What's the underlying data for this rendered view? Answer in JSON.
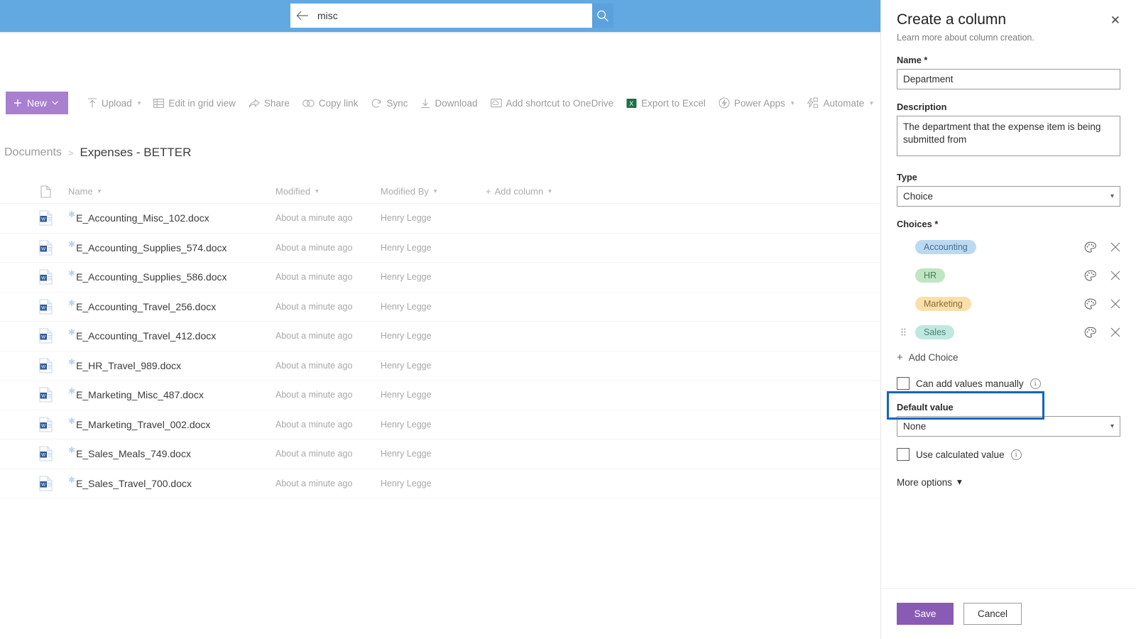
{
  "topbar": {
    "search_value": "misc",
    "search_placeholder": "Search",
    "back_icon": "back-arrow-icon",
    "search_icon": "search-icon"
  },
  "commandbar": {
    "new_label": "New",
    "items": [
      {
        "label": "Upload",
        "icon": "upload-icon",
        "caret": true
      },
      {
        "label": "Edit in grid view",
        "icon": "grid-icon",
        "caret": false
      },
      {
        "label": "Share",
        "icon": "share-icon",
        "caret": false
      },
      {
        "label": "Copy link",
        "icon": "link-icon",
        "caret": false
      },
      {
        "label": "Sync",
        "icon": "sync-icon",
        "caret": false
      },
      {
        "label": "Download",
        "icon": "download-icon",
        "caret": false
      },
      {
        "label": "Add shortcut to OneDrive",
        "icon": "onedrive-shortcut-icon",
        "caret": false
      },
      {
        "label": "Export to Excel",
        "icon": "excel-icon",
        "caret": false
      },
      {
        "label": "Power Apps",
        "icon": "power-apps-icon",
        "caret": true
      },
      {
        "label": "Automate",
        "icon": "automate-icon",
        "caret": true
      }
    ]
  },
  "breadcrumb": {
    "root": "Documents",
    "separator": ">",
    "current": "Expenses - BETTER"
  },
  "filelist": {
    "columns": {
      "name": "Name",
      "modified": "Modified",
      "modified_by": "Modified By",
      "add_column": "Add column"
    },
    "rows": [
      {
        "name": "E_Accounting_Misc_102.docx",
        "modified": "About a minute ago",
        "modified_by": "Henry Legge"
      },
      {
        "name": "E_Accounting_Supplies_574.docx",
        "modified": "About a minute ago",
        "modified_by": "Henry Legge"
      },
      {
        "name": "E_Accounting_Supplies_586.docx",
        "modified": "About a minute ago",
        "modified_by": "Henry Legge"
      },
      {
        "name": "E_Accounting_Travel_256.docx",
        "modified": "About a minute ago",
        "modified_by": "Henry Legge"
      },
      {
        "name": "E_Accounting_Travel_412.docx",
        "modified": "About a minute ago",
        "modified_by": "Henry Legge"
      },
      {
        "name": "E_HR_Travel_989.docx",
        "modified": "About a minute ago",
        "modified_by": "Henry Legge"
      },
      {
        "name": "E_Marketing_Misc_487.docx",
        "modified": "About a minute ago",
        "modified_by": "Henry Legge"
      },
      {
        "name": "E_Marketing_Travel_002.docx",
        "modified": "About a minute ago",
        "modified_by": "Henry Legge"
      },
      {
        "name": "E_Sales_Meals_749.docx",
        "modified": "About a minute ago",
        "modified_by": "Henry Legge"
      },
      {
        "name": "E_Sales_Travel_700.docx",
        "modified": "About a minute ago",
        "modified_by": "Henry Legge"
      }
    ]
  },
  "panel": {
    "title": "Create a column",
    "subtitle": "Learn more about column creation.",
    "close_icon": "close-icon",
    "name_label": "Name *",
    "name_value": "Department",
    "description_label": "Description",
    "description_value": "The department that the expense item is being submitted from",
    "type_label": "Type",
    "type_value": "Choice",
    "choices_label": "Choices *",
    "choices": [
      {
        "label": "Accounting",
        "bg": "#bcd9f2",
        "fg": "#4a6f8f",
        "drag": false
      },
      {
        "label": "HR",
        "bg": "#bfe6c2",
        "fg": "#4f7a53",
        "drag": false
      },
      {
        "label": "Marketing",
        "bg": "#fadfab",
        "fg": "#8a6d32",
        "drag": false
      },
      {
        "label": "Sales",
        "bg": "#bfe8e0",
        "fg": "#4a7f77",
        "drag": true
      }
    ],
    "add_choice_label": "Add Choice",
    "can_add_values_label": "Can add values manually",
    "can_add_values_checked": false,
    "default_value_label": "Default value",
    "default_value": "None",
    "use_calculated_label": "Use calculated value",
    "use_calculated_checked": false,
    "more_options_label": "More options",
    "save_label": "Save",
    "cancel_label": "Cancel",
    "highlight_color": "#1565c0"
  }
}
